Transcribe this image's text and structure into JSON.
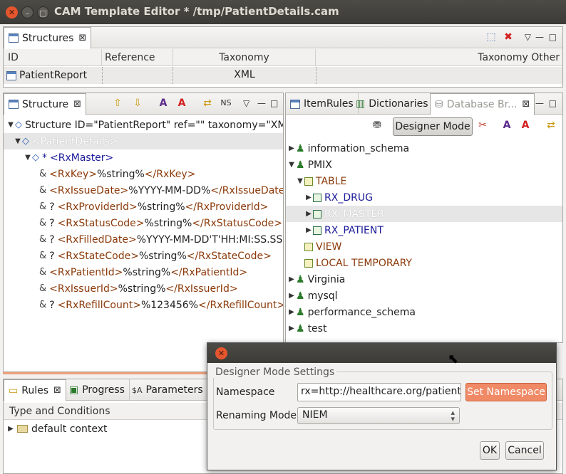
{
  "window": {
    "title": "CAM Template Editor * /tmp/PatientDetails.cam"
  },
  "structures_panel": {
    "tab_label": "Structures",
    "columns": [
      "ID",
      "Reference",
      "Taxonomy",
      "Taxonomy Other"
    ],
    "rows": [
      {
        "id": "PatientReport",
        "reference": "",
        "taxonomy": "XML",
        "taxonomy_other": ""
      }
    ]
  },
  "structure_panel": {
    "tab_label": "Structure",
    "nodes": [
      {
        "text": "Structure ID=\"PatientReport\" ref=\"\" taxonomy=\"XML\""
      },
      {
        "text": "<PatientDetails>"
      },
      {
        "prefix": "*",
        "text": "<RxMaster>"
      },
      {
        "open": "<RxKey>",
        "value": "%string%",
        "close": "</RxKey>"
      },
      {
        "open": "<RxIssueDate>",
        "value": "%YYYY-MM-DD%",
        "close": "</RxIssueDate>"
      },
      {
        "prefix": "?",
        "open": "<RxProviderId>",
        "value": "%string%",
        "close": "</RxProviderId>"
      },
      {
        "prefix": "?",
        "open": "<RxStatusCode>",
        "value": "%string%",
        "close": "</RxStatusCode>"
      },
      {
        "prefix": "?",
        "open": "<RxFilledDate>",
        "value": "%YYYY-MM-DD'T'HH:MI:SS.SSS",
        "close": ""
      },
      {
        "prefix": "?",
        "open": "<RxStateCode>",
        "value": "%string%",
        "close": "</RxStateCode>"
      },
      {
        "open": "<RxPatientId>",
        "value": "%string%",
        "close": "</RxPatientId>"
      },
      {
        "open": "<RxIssuerId>",
        "value": "%string%",
        "close": "</RxIssuerId>"
      },
      {
        "prefix": "?",
        "open": "<RxRefillCount>",
        "value": "%123456%",
        "close": "</RxRefillCount>"
      }
    ]
  },
  "right_tabs": {
    "item_rules": "ItemRules",
    "dictionaries": "Dictionaries",
    "database_browser": "Database Br..."
  },
  "db_toolbar": {
    "designer_mode": "Designer Mode"
  },
  "db_tree": {
    "information_schema": "information_schema",
    "pmix": "PMIX",
    "table": "TABLE",
    "rx_drug": "RX_DRUG",
    "rx_master": "RX_MASTER",
    "rx_patient": "RX_PATIENT",
    "view": "VIEW",
    "local_temporary": "LOCAL TEMPORARY",
    "virginia": "Virginia",
    "mysql": "mysql",
    "performance_schema": "performance_schema",
    "test": "test"
  },
  "bottom_tabs": {
    "rules": "Rules",
    "progress": "Progress",
    "parameters": "Parameters"
  },
  "rules_panel": {
    "column": "Type and Conditions",
    "item": "default context"
  },
  "dialog": {
    "group_title": "Designer Mode Settings",
    "namespace_label": "Namespace",
    "namespace_value": "rx=http://healthcare.org/patients",
    "set_namespace": "Set Namespace",
    "renaming_label": "Renaming Mode",
    "renaming_value": "NIEM",
    "ok": "OK",
    "cancel": "Cancel"
  },
  "colors": {
    "accent": "#e95420",
    "set_namespace_bg": "#f08a66",
    "selection": "#e6e6e6"
  }
}
